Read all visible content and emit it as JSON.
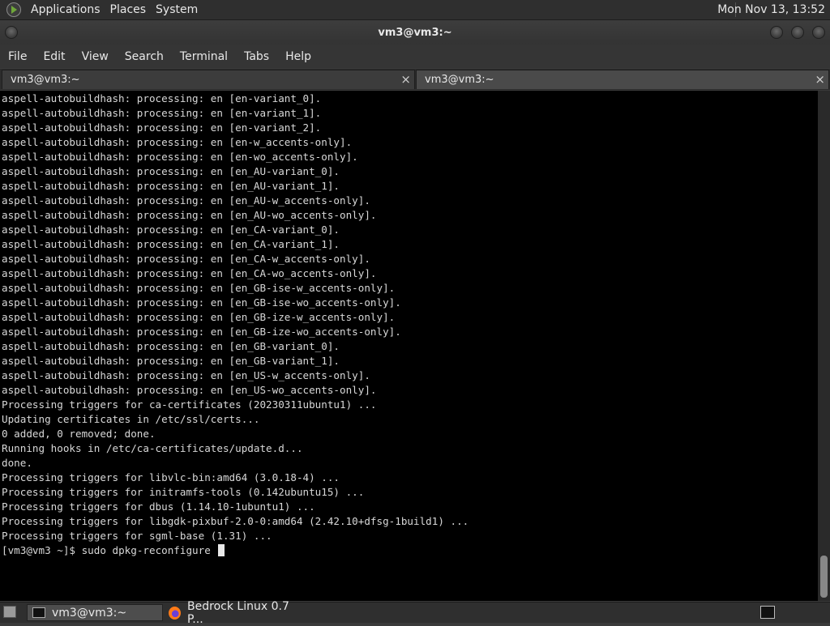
{
  "top_panel": {
    "menus": [
      "Applications",
      "Places",
      "System"
    ],
    "clock": "Mon Nov 13, 13:52"
  },
  "window": {
    "title": "vm3@vm3:~"
  },
  "menubar": [
    "File",
    "Edit",
    "View",
    "Search",
    "Terminal",
    "Tabs",
    "Help"
  ],
  "tabs": [
    {
      "label": "vm3@vm3:~",
      "close": "×"
    },
    {
      "label": "vm3@vm3:~",
      "close": "×"
    }
  ],
  "terminal": {
    "lines": [
      "aspell-autobuildhash: processing: en [en-variant_0].",
      "aspell-autobuildhash: processing: en [en-variant_1].",
      "aspell-autobuildhash: processing: en [en-variant_2].",
      "aspell-autobuildhash: processing: en [en-w_accents-only].",
      "aspell-autobuildhash: processing: en [en-wo_accents-only].",
      "aspell-autobuildhash: processing: en [en_AU-variant_0].",
      "aspell-autobuildhash: processing: en [en_AU-variant_1].",
      "aspell-autobuildhash: processing: en [en_AU-w_accents-only].",
      "aspell-autobuildhash: processing: en [en_AU-wo_accents-only].",
      "aspell-autobuildhash: processing: en [en_CA-variant_0].",
      "aspell-autobuildhash: processing: en [en_CA-variant_1].",
      "aspell-autobuildhash: processing: en [en_CA-w_accents-only].",
      "aspell-autobuildhash: processing: en [en_CA-wo_accents-only].",
      "aspell-autobuildhash: processing: en [en_GB-ise-w_accents-only].",
      "aspell-autobuildhash: processing: en [en_GB-ise-wo_accents-only].",
      "aspell-autobuildhash: processing: en [en_GB-ize-w_accents-only].",
      "aspell-autobuildhash: processing: en [en_GB-ize-wo_accents-only].",
      "aspell-autobuildhash: processing: en [en_GB-variant_0].",
      "aspell-autobuildhash: processing: en [en_GB-variant_1].",
      "aspell-autobuildhash: processing: en [en_US-w_accents-only].",
      "aspell-autobuildhash: processing: en [en_US-wo_accents-only].",
      "Processing triggers for ca-certificates (20230311ubuntu1) ...",
      "Updating certificates in /etc/ssl/certs...",
      "0 added, 0 removed; done.",
      "Running hooks in /etc/ca-certificates/update.d...",
      "done.",
      "Processing triggers for libvlc-bin:amd64 (3.0.18-4) ...",
      "Processing triggers for initramfs-tools (0.142ubuntu15) ...",
      "Processing triggers for dbus (1.14.10-1ubuntu1) ...",
      "Processing triggers for libgdk-pixbuf-2.0-0:amd64 (2.42.10+dfsg-1build1) ...",
      "Processing triggers for sgml-base (1.31) ..."
    ],
    "prompt": "[vm3@vm3 ~]$ ",
    "command": "sudo dpkg-reconfigure "
  },
  "taskbar": {
    "tasks": [
      {
        "label": "vm3@vm3:~",
        "icon": "terminal-icon",
        "active": true
      },
      {
        "label": "Bedrock Linux 0.7 P...",
        "icon": "firefox-icon",
        "active": false
      }
    ]
  },
  "colors": {
    "terminal_bg": "#000000",
    "terminal_fg": "#d8d8d8",
    "panel_bg": "#2f2f2f"
  }
}
